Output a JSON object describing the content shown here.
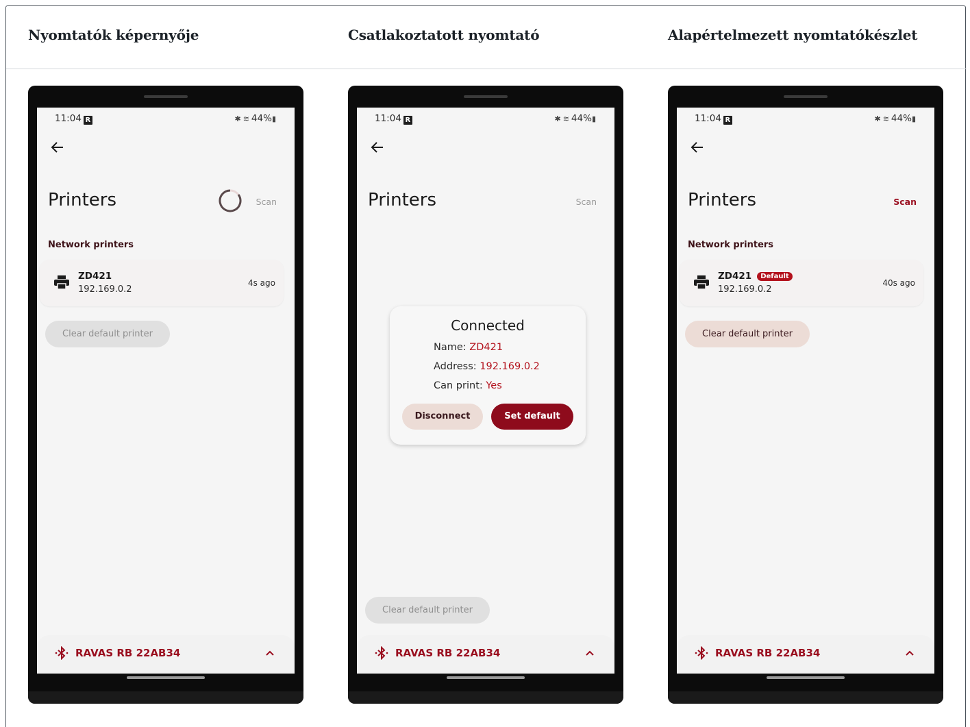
{
  "columns": [
    {
      "heading": "Nyomtatók képernyője",
      "status": {
        "time": "11:04",
        "badge": "R",
        "battery": "44%"
      },
      "title": "Printers",
      "scan": "Scan",
      "section": "Network printers",
      "printer": {
        "name": "ZD421",
        "address": "192.169.0.2",
        "ago": "4s ago"
      },
      "clear_button": "Clear default printer",
      "bt_device": "RAVAS RB 22AB34"
    },
    {
      "heading": "Csatlakoztatott nyomtató",
      "status": {
        "time": "11:04",
        "badge": "R",
        "battery": "44%"
      },
      "title": "Printers",
      "scan": "Scan",
      "dialog": {
        "title": "Connected",
        "name_label": "Name: ",
        "name_value": "ZD421",
        "address_label": "Address: ",
        "address_value": "192.169.0.2",
        "canprint_label": "Can print: ",
        "canprint_value": "Yes",
        "disconnect": "Disconnect",
        "set_default": "Set default"
      },
      "clear_button": "Clear default printer",
      "bt_device": "RAVAS RB 22AB34"
    },
    {
      "heading": "Alapértelmezett nyomtatókészlet",
      "status": {
        "time": "11:04",
        "badge": "R",
        "battery": "44%"
      },
      "title": "Printers",
      "scan": "Scan",
      "section": "Network printers",
      "printer": {
        "name": "ZD421",
        "badge": "Default",
        "address": "192.169.0.2",
        "ago": "40s ago"
      },
      "clear_button": "Clear default printer",
      "bt_device": "RAVAS RB 22AB34"
    }
  ],
  "colors": {
    "accent": "#9a0e1f",
    "accent_dark": "#8e0b1c",
    "tonal": "#ecdcd6",
    "screen_bg": "#f5f5f5"
  }
}
